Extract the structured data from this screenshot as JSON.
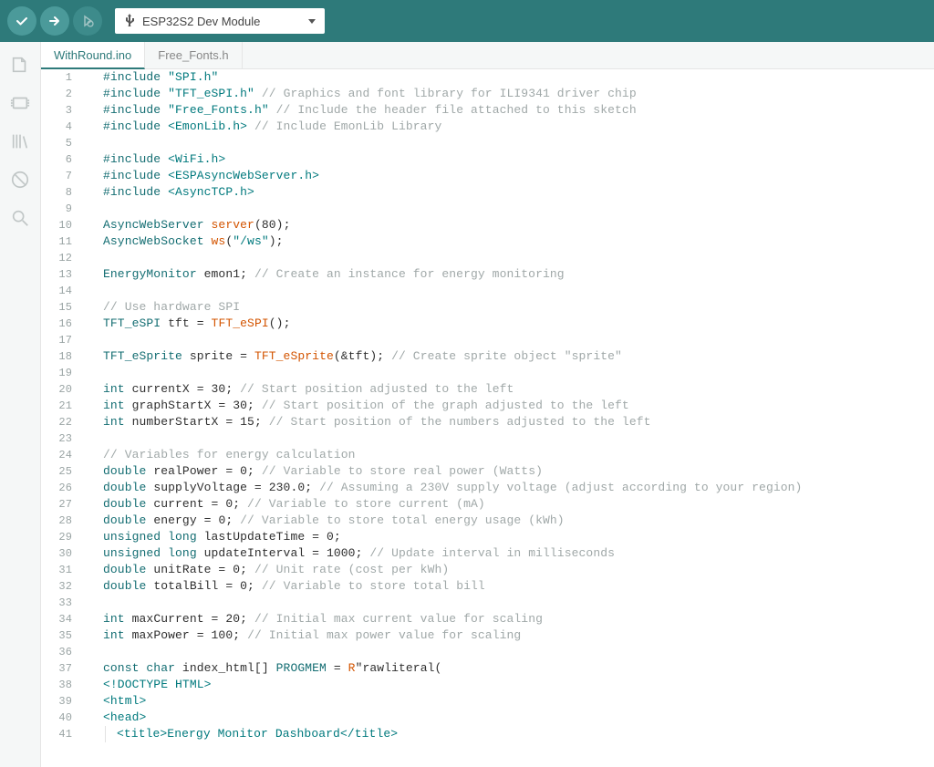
{
  "toolbar": {
    "board_name": "ESP32S2 Dev Module"
  },
  "tabs": [
    {
      "label": "WithRound.ino",
      "active": true
    },
    {
      "label": "Free_Fonts.h",
      "active": false
    }
  ],
  "code": {
    "lines": [
      {
        "n": 1,
        "seg": [
          [
            "k",
            "#include "
          ],
          [
            "s",
            "\"SPI.h\""
          ]
        ]
      },
      {
        "n": 2,
        "seg": [
          [
            "k",
            "#include "
          ],
          [
            "s",
            "\"TFT_eSPI.h\""
          ],
          [
            "n",
            " "
          ],
          [
            "c",
            "// Graphics and font library for ILI9341 driver chip"
          ]
        ]
      },
      {
        "n": 3,
        "seg": [
          [
            "k",
            "#include "
          ],
          [
            "s",
            "\"Free_Fonts.h\""
          ],
          [
            "n",
            " "
          ],
          [
            "c",
            "// Include the header file attached to this sketch"
          ]
        ]
      },
      {
        "n": 4,
        "seg": [
          [
            "k",
            "#include "
          ],
          [
            "s",
            "<EmonLib.h>"
          ],
          [
            "n",
            " "
          ],
          [
            "c",
            "// Include EmonLib Library"
          ]
        ]
      },
      {
        "n": 5,
        "seg": []
      },
      {
        "n": 6,
        "seg": [
          [
            "k",
            "#include "
          ],
          [
            "s",
            "<WiFi.h>"
          ]
        ]
      },
      {
        "n": 7,
        "seg": [
          [
            "k",
            "#include "
          ],
          [
            "s",
            "<ESPAsyncWebServer.h>"
          ]
        ]
      },
      {
        "n": 8,
        "seg": [
          [
            "k",
            "#include "
          ],
          [
            "s",
            "<AsyncTCP.h>"
          ]
        ]
      },
      {
        "n": 9,
        "seg": []
      },
      {
        "n": 10,
        "seg": [
          [
            "t",
            "AsyncWebServer "
          ],
          [
            "f",
            "server"
          ],
          [
            "n",
            "("
          ],
          [
            "n",
            "80"
          ],
          [
            "n",
            ");"
          ]
        ]
      },
      {
        "n": 11,
        "seg": [
          [
            "t",
            "AsyncWebSocket "
          ],
          [
            "f",
            "ws"
          ],
          [
            "n",
            "("
          ],
          [
            "s",
            "\"/ws\""
          ],
          [
            "n",
            ");"
          ]
        ]
      },
      {
        "n": 12,
        "seg": []
      },
      {
        "n": 13,
        "seg": [
          [
            "t",
            "EnergyMonitor "
          ],
          [
            "n",
            "emon1; "
          ],
          [
            "c",
            "// Create an instance for energy monitoring"
          ]
        ]
      },
      {
        "n": 14,
        "seg": []
      },
      {
        "n": 15,
        "seg": [
          [
            "c",
            "// Use hardware SPI"
          ]
        ]
      },
      {
        "n": 16,
        "seg": [
          [
            "t",
            "TFT_eSPI "
          ],
          [
            "n",
            "tft = "
          ],
          [
            "f",
            "TFT_eSPI"
          ],
          [
            "n",
            "();"
          ]
        ]
      },
      {
        "n": 17,
        "seg": []
      },
      {
        "n": 18,
        "seg": [
          [
            "t",
            "TFT_eSprite "
          ],
          [
            "n",
            "sprite = "
          ],
          [
            "f",
            "TFT_eSprite"
          ],
          [
            "n",
            "(&tft); "
          ],
          [
            "c",
            "// Create sprite object \"sprite\""
          ]
        ]
      },
      {
        "n": 19,
        "seg": []
      },
      {
        "n": 20,
        "seg": [
          [
            "k",
            "int "
          ],
          [
            "n",
            "currentX = "
          ],
          [
            "n",
            "30"
          ],
          [
            "n",
            "; "
          ],
          [
            "c",
            "// Start position adjusted to the left"
          ]
        ]
      },
      {
        "n": 21,
        "seg": [
          [
            "k",
            "int "
          ],
          [
            "n",
            "graphStartX = "
          ],
          [
            "n",
            "30"
          ],
          [
            "n",
            "; "
          ],
          [
            "c",
            "// Start position of the graph adjusted to the left"
          ]
        ]
      },
      {
        "n": 22,
        "seg": [
          [
            "k",
            "int "
          ],
          [
            "n",
            "numberStartX = "
          ],
          [
            "n",
            "15"
          ],
          [
            "n",
            "; "
          ],
          [
            "c",
            "// Start position of the numbers adjusted to the left"
          ]
        ]
      },
      {
        "n": 23,
        "seg": []
      },
      {
        "n": 24,
        "seg": [
          [
            "c",
            "// Variables for energy calculation"
          ]
        ]
      },
      {
        "n": 25,
        "seg": [
          [
            "k",
            "double "
          ],
          [
            "n",
            "realPower = "
          ],
          [
            "n",
            "0"
          ],
          [
            "n",
            "; "
          ],
          [
            "c",
            "// Variable to store real power (Watts)"
          ]
        ]
      },
      {
        "n": 26,
        "seg": [
          [
            "k",
            "double "
          ],
          [
            "n",
            "supplyVoltage = "
          ],
          [
            "n",
            "230.0"
          ],
          [
            "n",
            "; "
          ],
          [
            "c",
            "// Assuming a 230V supply voltage (adjust according to your region)"
          ]
        ]
      },
      {
        "n": 27,
        "seg": [
          [
            "k",
            "double "
          ],
          [
            "n",
            "current = "
          ],
          [
            "n",
            "0"
          ],
          [
            "n",
            "; "
          ],
          [
            "c",
            "// Variable to store current (mA)"
          ]
        ]
      },
      {
        "n": 28,
        "seg": [
          [
            "k",
            "double "
          ],
          [
            "n",
            "energy = "
          ],
          [
            "n",
            "0"
          ],
          [
            "n",
            "; "
          ],
          [
            "c",
            "// Variable to store total energy usage (kWh)"
          ]
        ]
      },
      {
        "n": 29,
        "seg": [
          [
            "k",
            "unsigned long "
          ],
          [
            "n",
            "lastUpdateTime = "
          ],
          [
            "n",
            "0"
          ],
          [
            "n",
            ";"
          ]
        ]
      },
      {
        "n": 30,
        "seg": [
          [
            "k",
            "unsigned long "
          ],
          [
            "n",
            "updateInterval = "
          ],
          [
            "n",
            "1000"
          ],
          [
            "n",
            "; "
          ],
          [
            "c",
            "// Update interval in milliseconds"
          ]
        ]
      },
      {
        "n": 31,
        "seg": [
          [
            "k",
            "double "
          ],
          [
            "n",
            "unitRate = "
          ],
          [
            "n",
            "0"
          ],
          [
            "n",
            "; "
          ],
          [
            "c",
            "// Unit rate (cost per kWh)"
          ]
        ]
      },
      {
        "n": 32,
        "seg": [
          [
            "k",
            "double "
          ],
          [
            "n",
            "totalBill = "
          ],
          [
            "n",
            "0"
          ],
          [
            "n",
            "; "
          ],
          [
            "c",
            "// Variable to store total bill"
          ]
        ]
      },
      {
        "n": 33,
        "seg": []
      },
      {
        "n": 34,
        "seg": [
          [
            "k",
            "int "
          ],
          [
            "n",
            "maxCurrent = "
          ],
          [
            "n",
            "20"
          ],
          [
            "n",
            "; "
          ],
          [
            "c",
            "// Initial max current value for scaling"
          ]
        ]
      },
      {
        "n": 35,
        "seg": [
          [
            "k",
            "int "
          ],
          [
            "n",
            "maxPower = "
          ],
          [
            "n",
            "100"
          ],
          [
            "n",
            "; "
          ],
          [
            "c",
            "// Initial max power value for scaling"
          ]
        ]
      },
      {
        "n": 36,
        "seg": []
      },
      {
        "n": 37,
        "seg": [
          [
            "k",
            "const char "
          ],
          [
            "n",
            "index_html[] "
          ],
          [
            "t",
            "PROGMEM"
          ],
          [
            "n",
            " = "
          ],
          [
            "f",
            "R"
          ],
          [
            "n",
            "\"rawliteral("
          ]
        ]
      },
      {
        "n": 38,
        "seg": [
          [
            "s",
            "<!DOCTYPE HTML>"
          ]
        ]
      },
      {
        "n": 39,
        "seg": [
          [
            "s",
            "<html>"
          ]
        ]
      },
      {
        "n": 40,
        "seg": [
          [
            "s",
            "<head>"
          ]
        ]
      },
      {
        "n": 41,
        "seg": [
          [
            "ig",
            "  "
          ],
          [
            "s",
            "<title>Energy Monitor Dashboard</title>"
          ]
        ],
        "indentGuide": true
      }
    ]
  }
}
